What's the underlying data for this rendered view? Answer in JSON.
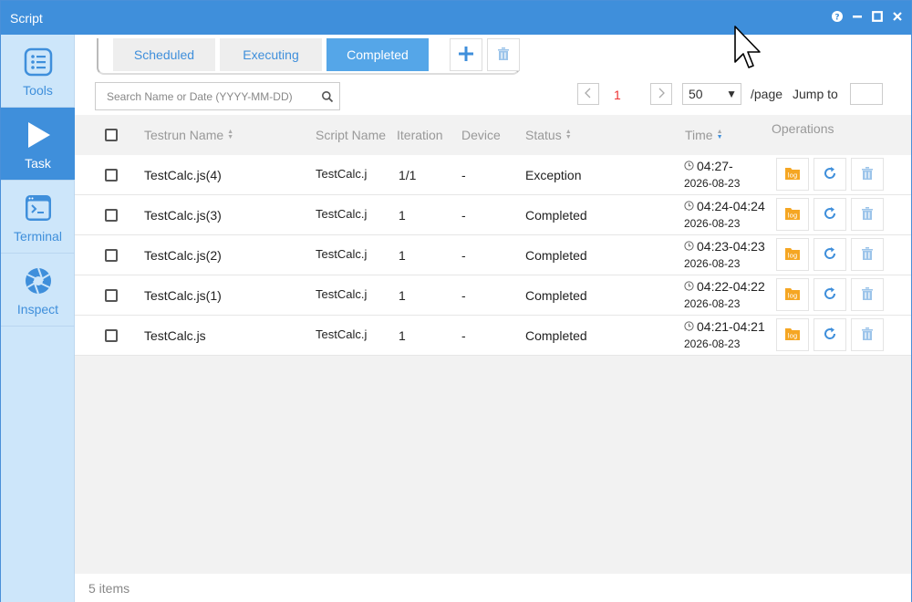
{
  "window": {
    "title": "Script"
  },
  "sidebar": {
    "items": [
      {
        "label": "Tools",
        "icon": "list-icon"
      },
      {
        "label": "Task",
        "icon": "play-icon"
      },
      {
        "label": "Terminal",
        "icon": "terminal-icon"
      },
      {
        "label": "Inspect",
        "icon": "aperture-icon"
      }
    ]
  },
  "tabs": [
    {
      "label": "Scheduled"
    },
    {
      "label": "Executing"
    },
    {
      "label": "Completed"
    }
  ],
  "search": {
    "placeholder": "Search Name or Date (YYYY-MM-DD)"
  },
  "pager": {
    "current_page": "1",
    "page_size": "50",
    "per_page_label": "/page",
    "jump_to_label": "Jump to"
  },
  "table": {
    "headers": {
      "testrun_name": "Testrun Name",
      "script_name": "Script Name",
      "iteration": "Iteration",
      "device": "Device",
      "status": "Status",
      "time": "Time",
      "operations": "Operations"
    },
    "rows": [
      {
        "testrun_name": "TestCalc.js(4)",
        "script_name": "TestCalc.j",
        "iteration": "1/1",
        "device": "-",
        "status": "Exception",
        "time": "04:27-",
        "date": "2026-08-23"
      },
      {
        "testrun_name": "TestCalc.js(3)",
        "script_name": "TestCalc.j",
        "iteration": "1",
        "device": "-",
        "status": "Completed",
        "time": "04:24-04:24",
        "date": "2026-08-23"
      },
      {
        "testrun_name": "TestCalc.js(2)",
        "script_name": "TestCalc.j",
        "iteration": "1",
        "device": "-",
        "status": "Completed",
        "time": "04:23-04:23",
        "date": "2026-08-23"
      },
      {
        "testrun_name": "TestCalc.js(1)",
        "script_name": "TestCalc.j",
        "iteration": "1",
        "device": "-",
        "status": "Completed",
        "time": "04:22-04:22",
        "date": "2026-08-23"
      },
      {
        "testrun_name": "TestCalc.js",
        "script_name": "TestCalc.j",
        "iteration": "1",
        "device": "-",
        "status": "Completed",
        "time": "04:21-04:21",
        "date": "2026-08-23"
      }
    ]
  },
  "footer": {
    "count": "5 items"
  },
  "colors": {
    "accent": "#3f8fdb",
    "sidebar_bg": "#cde6fa",
    "log_orange": "#f5a623",
    "page_red": "#e33333"
  }
}
